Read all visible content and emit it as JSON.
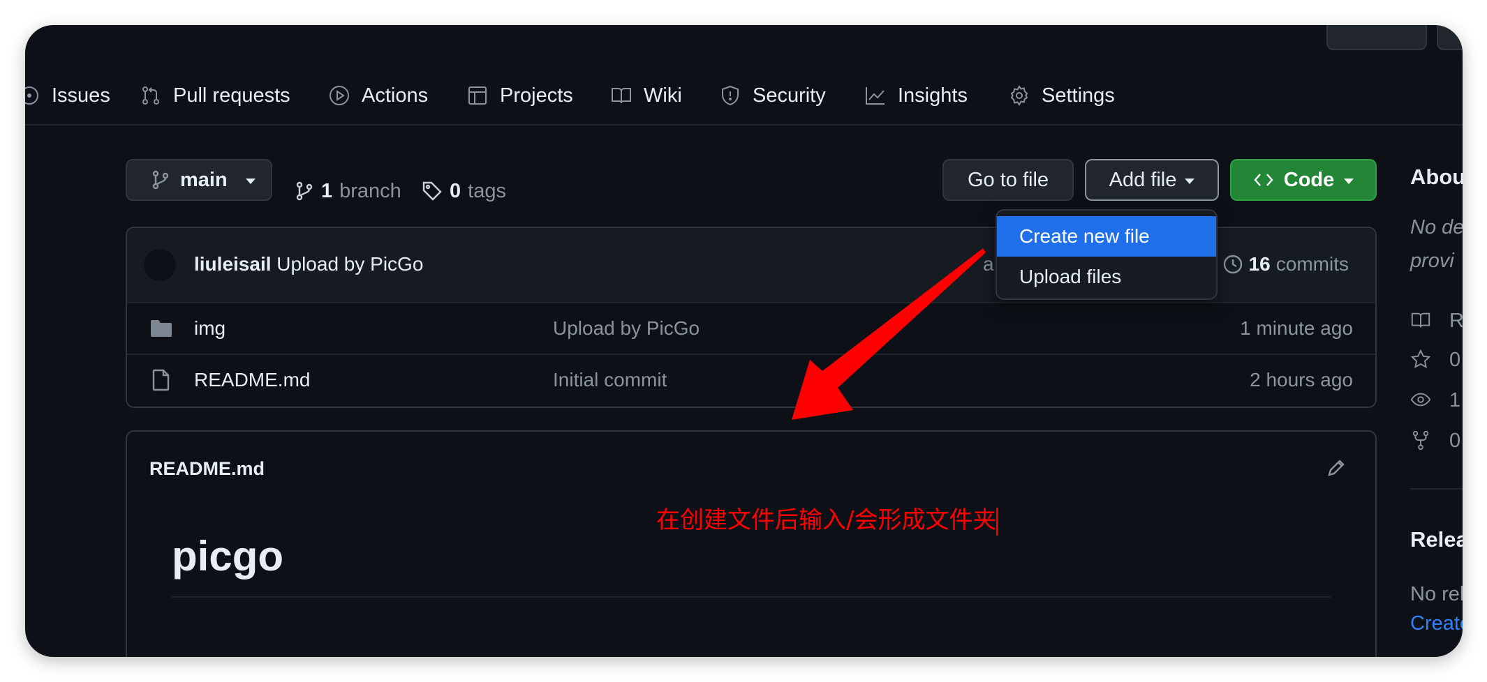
{
  "nav": {
    "issues": "Issues",
    "pull_requests": "Pull requests",
    "actions": "Actions",
    "projects": "Projects",
    "wiki": "Wiki",
    "security": "Security",
    "insights": "Insights",
    "settings": "Settings"
  },
  "branch_select": {
    "label": "main"
  },
  "stats": {
    "branch_count": "1",
    "branch_label": "branch",
    "tag_count": "0",
    "tag_label": "tags"
  },
  "actions": {
    "go_to_file": "Go to file",
    "add_file": "Add file",
    "code": "Code"
  },
  "add_file_menu": {
    "items": [
      "Create new file",
      "Upload files"
    ],
    "selected_index": 0
  },
  "commit": {
    "author": "liuleisail",
    "message": "Upload by PicGo",
    "time_partial": "a",
    "commit_count": "16",
    "commit_label": "commits"
  },
  "files": [
    {
      "name": "img",
      "type": "folder",
      "message": "Upload by PicGo",
      "age": "1 minute ago"
    },
    {
      "name": "README.md",
      "type": "file",
      "message": "Initial commit",
      "age": "2 hours ago"
    }
  ],
  "readme": {
    "filename": "README.md",
    "heading": "picgo"
  },
  "annotation": {
    "text": "在创建文件后输入/会形成文件夹",
    "color": "#ff0000"
  },
  "sidebar": {
    "about_title": "Abou",
    "desc_line1": "No de",
    "desc_line2": "provi",
    "readme": "R",
    "stars": "0",
    "watchers": "1",
    "forks": "0",
    "releases_title": "Relea",
    "no_releases": "No rel",
    "create_link": "Create"
  },
  "colors": {
    "background": "#0d1117",
    "accent_blue": "#1f6feb",
    "code_green": "#238636",
    "link_blue": "#2f81f7"
  }
}
